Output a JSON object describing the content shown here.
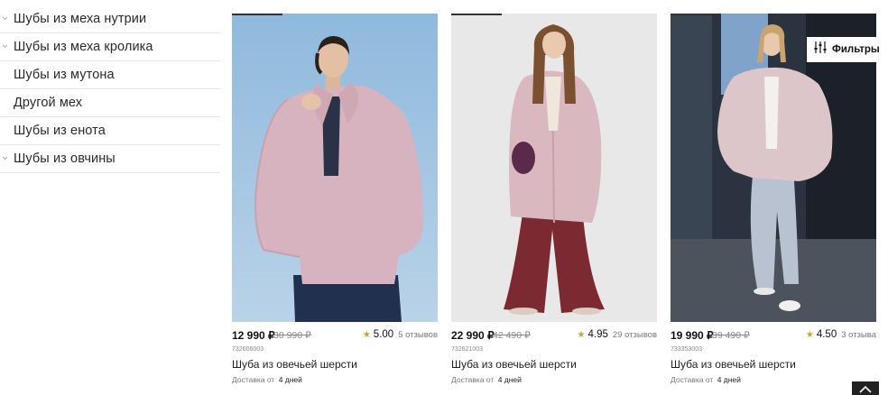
{
  "sidebar": {
    "items": [
      {
        "label": "Шубы из меха нутрии"
      },
      {
        "label": "Шубы из меха кролика"
      },
      {
        "label": "Шубы из мутона"
      },
      {
        "label": "Другой мех"
      },
      {
        "label": "Шубы из енота"
      },
      {
        "label": "Шубы из овчины"
      }
    ]
  },
  "filters": {
    "label": "Фильтры",
    "icon": "sliders-icon"
  },
  "products": [
    {
      "price": "12 990 ₽",
      "old_price": "30 990 ₽",
      "rating": "5.00",
      "reviews": "5 отзывов",
      "sku": "732606003",
      "name": "Шуба из овечьей шерсти",
      "delivery_label": "Доставка от",
      "delivery_value": "4 дней"
    },
    {
      "price": "22 990 ₽",
      "old_price": "42 490 ₽",
      "rating": "4.95",
      "reviews": "29 отзывов",
      "sku": "732621003",
      "name": "Шуба из овечьей шерсти",
      "delivery_label": "Доставка от",
      "delivery_value": "4 дней"
    },
    {
      "price": "19 990 ₽",
      "old_price": "39 490 ₽",
      "rating": "4.50",
      "reviews": "3 отзыва",
      "sku": "733353003",
      "name": "Шуба из овечьей шерсти",
      "delivery_label": "Доставка от",
      "delivery_value": "4 дней"
    }
  ],
  "colors": {
    "star": "#c8a233",
    "coat_pink": "#d9b8bf"
  }
}
